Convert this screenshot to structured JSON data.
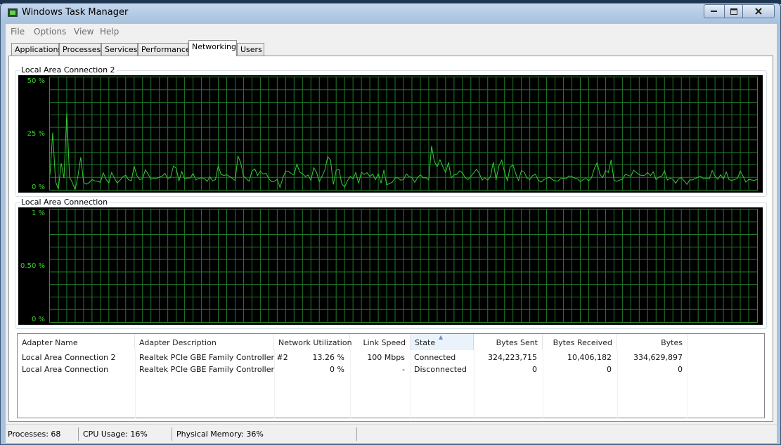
{
  "window": {
    "title": "Windows Task Manager"
  },
  "menu": [
    "File",
    "Options",
    "View",
    "Help"
  ],
  "tabs": [
    "Applications",
    "Processes",
    "Services",
    "Performance",
    "Networking",
    "Users"
  ],
  "active_tab": "Networking",
  "graphs": [
    {
      "title": "Local Area Connection 2",
      "y_labels": {
        "top": "50 %",
        "mid": "25 %",
        "bottom": "0 %"
      },
      "line_color": "#33cc33",
      "utilization_history_percent": [
        6.5,
        25.4,
        3.7,
        0.3,
        11.8,
        5.2,
        34.2,
        5.6,
        3.2,
        0.1,
        6.2,
        14.5,
        3.3,
        2.5,
        3.2,
        4.6,
        3.9,
        3.8,
        3.3,
        7.6,
        4.7,
        3.1,
        7.7,
        5.2,
        3.0,
        4.3,
        5.8,
        6.5,
        4.5,
        4.0,
        10.5,
        6.3,
        4.6,
        4.8,
        8.9,
        7.0,
        4.7,
        5.2,
        5.1,
        5.6,
        6.1,
        7.3,
        4.9,
        5.6,
        10.6,
        9.6,
        4.0,
        8.1,
        4.8,
        5.3,
        5.2,
        7.3,
        4.4,
        5.1,
        5.3,
        5.1,
        3.7,
        5.8,
        3.9,
        4.6,
        10.7,
        6.8,
        6.4,
        6.7,
        5.9,
        5.2,
        4.1,
        15.1,
        11.9,
        6.0,
        4.9,
        3.8,
        8.3,
        9.3,
        6.4,
        8.3,
        7.0,
        7.4,
        5.0,
        3.6,
        3.8,
        4.7,
        1.1,
        5.2,
        8.4,
        8.2,
        7.2,
        6.6,
        11.5,
        7.9,
        7.2,
        5.9,
        6.6,
        4.2,
        9.8,
        7.8,
        3.7,
        6.0,
        8.9,
        14.8,
        13.2,
        2.4,
        8.7,
        9.0,
        2.7,
        1.2,
        4.0,
        5.9,
        4.9,
        7.7,
        2.9,
        7.8,
        6.8,
        7.6,
        5.9,
        7.0,
        4.5,
        7.1,
        2.9,
        8.8,
        2.2,
        2.8,
        3.3,
        5.3,
        5.3,
        4.3,
        4.5,
        7.1,
        5.8,
        5.5,
        3.3,
        5.5,
        6.7,
        5.3,
        5.4,
        4.4,
        19.4,
        12.6,
        10.3,
        13.3,
        10.4,
        7.7,
        12.2,
        5.3,
        6.6,
        6.9,
        8.4,
        7.5,
        5.4,
        4.6,
        5.9,
        7.5,
        9.2,
        7.3,
        4.3,
        5.3,
        4.3,
        6.0,
        12.3,
        4.4,
        10.7,
        13.2,
        7.9,
        4.1,
        10.1,
        11.1,
        7.1,
        4.1,
        8.6,
        7.8,
        5.2,
        4.5,
        6.3,
        6.9,
        4.3,
        3.4,
        4.5,
        5.1,
        5.6,
        4.6,
        3.9,
        3.9,
        5.0,
        5.2,
        5.0,
        6.2,
        5.8,
        5.2,
        4.9,
        3.6,
        4.5,
        5.1,
        4.0,
        5.4,
        9.5,
        12.1,
        6.8,
        5.4,
        8.6,
        7.7,
        13.3,
        4.2,
        3.8,
        4.3,
        4.7,
        6.8,
        6.5,
        6.0,
        8.7,
        7.7,
        6.7,
        6.3,
        6.5,
        7.7,
        6.3,
        8.0,
        4.5,
        5.7,
        6.0,
        8.5,
        4.3,
        5.2,
        4.7,
        2.9,
        4.9,
        5.4,
        4.0,
        2.4,
        4.4,
        4.4,
        5.0,
        5.7,
        5.8,
        4.8,
        5.3,
        5.0,
        8.6,
        6.1,
        4.7,
        6.7,
        4.8,
        7.9,
        4.5,
        4.2,
        4.6,
        5.0,
        8.4,
        6.0,
        3.4,
        4.6,
        4.4,
        4.2,
        4.7
      ]
    },
    {
      "title": "Local Area Connection",
      "y_labels": {
        "top": "1 %",
        "mid": "0.50 %",
        "bottom": "0 %"
      },
      "line_color": "#33cc33",
      "utilization_history_percent": []
    }
  ],
  "table": {
    "columns": [
      "Adapter Name",
      "Adapter Description",
      "Network Utilization",
      "Link Speed",
      "State",
      "Bytes Sent",
      "Bytes Received",
      "Bytes"
    ],
    "sorted_column": "State",
    "rows": [
      [
        "Local Area Connection 2",
        "Realtek PCIe GBE Family Controller #2",
        "13.26 %",
        "100 Mbps",
        "Connected",
        "324,223,715",
        "10,406,182",
        "334,629,897"
      ],
      [
        "Local Area Connection",
        "Realtek PCIe GBE Family Controller",
        "0 %",
        "-",
        "Disconnected",
        "0",
        "0",
        "0"
      ]
    ]
  },
  "status": {
    "processes": "Processes: 68",
    "cpu": "CPU Usage: 16%",
    "memory": "Physical Memory: 36%"
  }
}
